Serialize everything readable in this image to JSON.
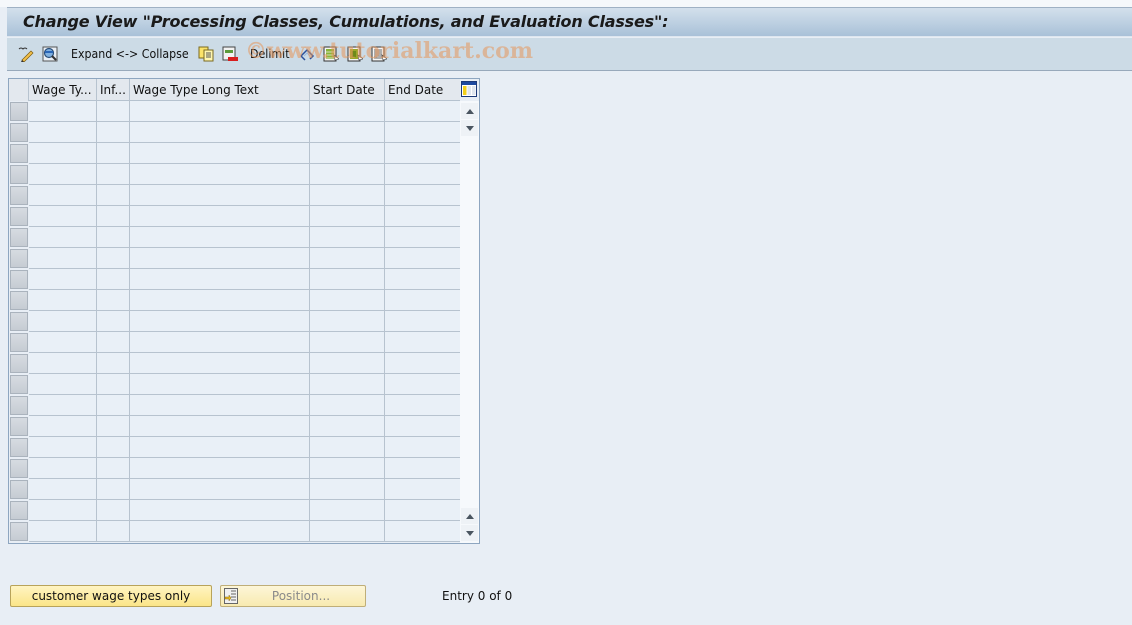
{
  "window": {
    "title": "Change View \"Processing Classes, Cumulations, and Evaluation Classes\":"
  },
  "toolbar": {
    "items": [
      {
        "icon": "display-change-icon"
      },
      {
        "icon": "details-icon"
      },
      {
        "label": "Expand <-> Collapse"
      },
      {
        "icon": "copy-icon"
      },
      {
        "icon": "delete-icon"
      },
      {
        "label": "Delimit"
      },
      {
        "icon": "undo-change-icon"
      },
      {
        "icon": "select-all-icon"
      },
      {
        "icon": "select-block-icon"
      },
      {
        "icon": "deselect-all-icon"
      }
    ],
    "expand_collapse_label": "Expand <-> Collapse",
    "delimit_label": "Delimit"
  },
  "watermark": "©www.tutorialkart.com",
  "table": {
    "columns": [
      {
        "label": "Wage Ty..."
      },
      {
        "label": "Inf..."
      },
      {
        "label": "Wage Type Long Text"
      },
      {
        "label": "Start Date"
      },
      {
        "label": "End Date"
      }
    ],
    "rows": [
      [
        "",
        "",
        "",
        "",
        ""
      ],
      [
        "",
        "",
        "",
        "",
        ""
      ],
      [
        "",
        "",
        "",
        "",
        ""
      ],
      [
        "",
        "",
        "",
        "",
        ""
      ],
      [
        "",
        "",
        "",
        "",
        ""
      ],
      [
        "",
        "",
        "",
        "",
        ""
      ],
      [
        "",
        "",
        "",
        "",
        ""
      ],
      [
        "",
        "",
        "",
        "",
        ""
      ],
      [
        "",
        "",
        "",
        "",
        ""
      ],
      [
        "",
        "",
        "",
        "",
        ""
      ],
      [
        "",
        "",
        "",
        "",
        ""
      ],
      [
        "",
        "",
        "",
        "",
        ""
      ],
      [
        "",
        "",
        "",
        "",
        ""
      ],
      [
        "",
        "",
        "",
        "",
        ""
      ],
      [
        "",
        "",
        "",
        "",
        ""
      ],
      [
        "",
        "",
        "",
        "",
        ""
      ],
      [
        "",
        "",
        "",
        "",
        ""
      ],
      [
        "",
        "",
        "",
        "",
        ""
      ],
      [
        "",
        "",
        "",
        "",
        ""
      ],
      [
        "",
        "",
        "",
        "",
        ""
      ],
      [
        "",
        "",
        "",
        "",
        ""
      ]
    ]
  },
  "footer": {
    "customer_button_label": "customer wage types only",
    "position_button_label": "Position...",
    "entry_text": "Entry 0 of 0"
  }
}
